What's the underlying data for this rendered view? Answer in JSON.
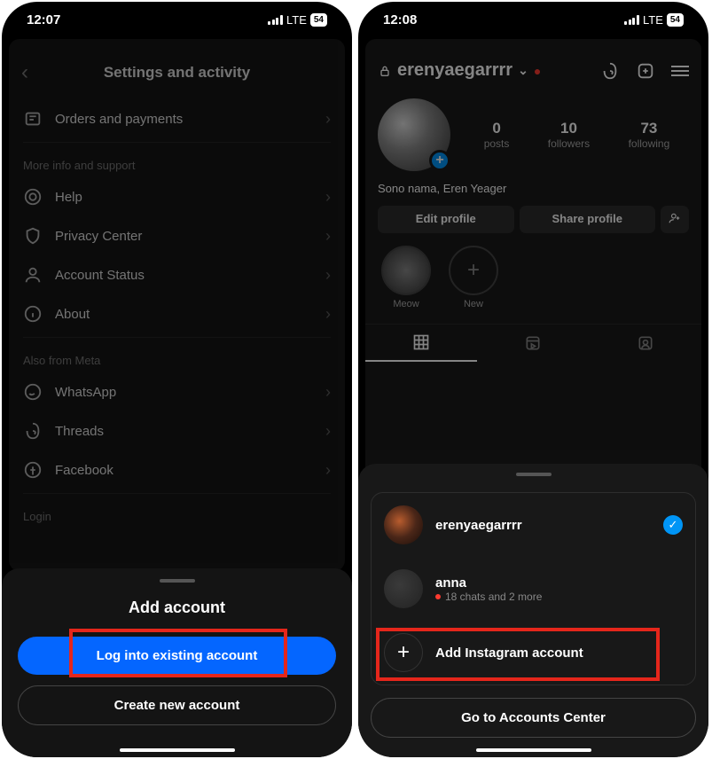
{
  "left": {
    "status": {
      "time": "12:07",
      "network": "LTE",
      "battery": "54"
    },
    "settings": {
      "title": "Settings and activity",
      "orders": "Orders and payments",
      "section_more": "More info and support",
      "help": "Help",
      "privacy": "Privacy Center",
      "account_status": "Account Status",
      "about": "About",
      "section_meta": "Also from Meta",
      "whatsapp": "WhatsApp",
      "threads": "Threads",
      "facebook": "Facebook",
      "login": "Login"
    },
    "sheet": {
      "title": "Add account",
      "login_btn": "Log into existing account",
      "create_btn": "Create new account"
    }
  },
  "right": {
    "status": {
      "time": "12:08",
      "network": "LTE",
      "battery": "54"
    },
    "profile": {
      "username": "erenyaegarrrr",
      "stats": {
        "posts": {
          "num": "0",
          "lbl": "posts"
        },
        "followers": {
          "num": "10",
          "lbl": "followers"
        },
        "following": {
          "num": "73",
          "lbl": "following"
        }
      },
      "bio": "Sono nama, Eren Yeager",
      "edit_btn": "Edit profile",
      "share_btn": "Share profile",
      "highlight1": "Meow",
      "highlight2": "New"
    },
    "sheet": {
      "account1": {
        "name": "erenyaegarrrr"
      },
      "account2": {
        "name": "anna",
        "sub": "18 chats and 2 more"
      },
      "add_btn": "Add Instagram account",
      "center_btn": "Go to Accounts Center"
    }
  }
}
